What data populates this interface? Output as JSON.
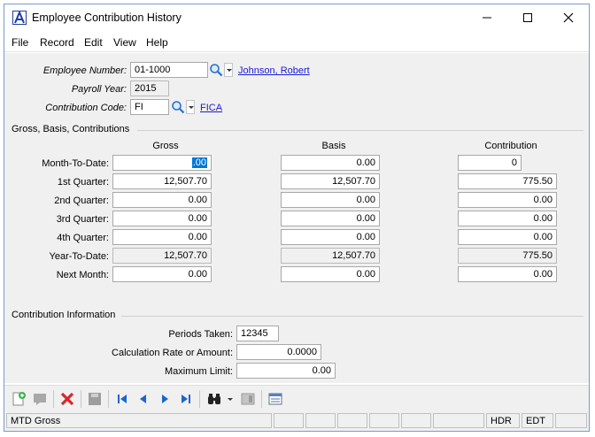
{
  "window": {
    "title": "Employee Contribution History"
  },
  "menu": {
    "items": [
      "File",
      "Record",
      "Edit",
      "View",
      "Help"
    ]
  },
  "header": {
    "employee_number_label": "Employee Number:",
    "employee_number_value": "01-1000",
    "employee_name": "Johnson, Robert",
    "payroll_year_label": "Payroll Year:",
    "payroll_year_value": "2015",
    "contribution_code_label": "Contribution Code:",
    "contribution_code_value": "FI",
    "contribution_code_desc": "FICA"
  },
  "grid": {
    "group_title": "Gross, Basis,  Contributions",
    "columns": [
      "Gross",
      "Basis",
      "Contribution"
    ],
    "rows": [
      {
        "label": "Month-To-Date:",
        "gross": ".00",
        "basis": "0.00",
        "contribution": "0"
      },
      {
        "label": "1st Quarter:",
        "gross": "12,507.70",
        "basis": "12,507.70",
        "contribution": "775.50"
      },
      {
        "label": "2nd Quarter:",
        "gross": "0.00",
        "basis": "0.00",
        "contribution": "0.00"
      },
      {
        "label": "3rd Quarter:",
        "gross": "0.00",
        "basis": "0.00",
        "contribution": "0.00"
      },
      {
        "label": "4th Quarter:",
        "gross": "0.00",
        "basis": "0.00",
        "contribution": "0.00"
      },
      {
        "label": "Year-To-Date:",
        "gross": "12,507.70",
        "basis": "12,507.70",
        "contribution": "775.50"
      },
      {
        "label": "Next Month:",
        "gross": "0.00",
        "basis": "0.00",
        "contribution": "0.00"
      }
    ]
  },
  "contribution_info": {
    "group_title": "Contribution Information",
    "periods_taken_label": "Periods Taken:",
    "periods_taken_value": "12345",
    "calc_rate_label": "Calculation Rate or Amount:",
    "calc_rate_value": "0.0000",
    "max_limit_label": "Maximum Limit:",
    "max_limit_value": "0.00"
  },
  "toolbar": {
    "icons": [
      "new-record-icon",
      "comment-icon",
      "delete-icon",
      "save-icon",
      "first-record-icon",
      "previous-record-icon",
      "next-record-icon",
      "last-record-icon",
      "find-icon",
      "find-dropdown-icon",
      "form-view-icon",
      "list-view-icon"
    ]
  },
  "status": {
    "message": "MTD Gross",
    "hdr": "HDR",
    "edt": "EDT"
  },
  "colors": {
    "accent": "#0078d7",
    "link": "#1a1ad6",
    "delete": "#d9262c",
    "nav": "#1e64d0"
  }
}
